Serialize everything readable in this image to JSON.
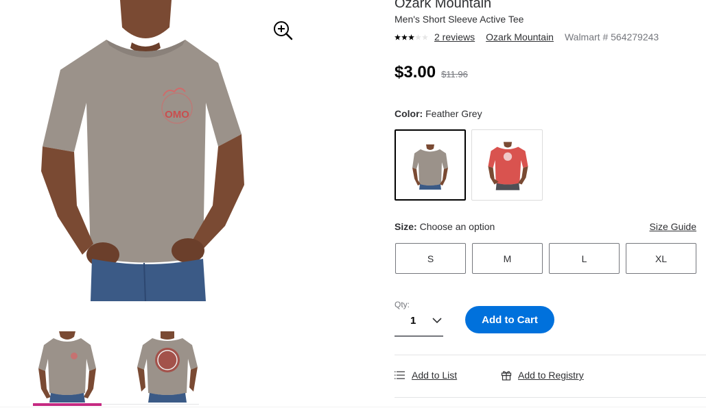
{
  "product": {
    "brand_title": "Ozark Mountain",
    "name": "Men's Short Sleeve Active Tee",
    "rating": 3,
    "rating_max": 5,
    "reviews_label": "2 reviews",
    "brand_link": "Ozark Mountain",
    "walmart_number": "Walmart # 564279243"
  },
  "pricing": {
    "current": "$3.00",
    "was": "$11.96"
  },
  "color": {
    "label": "Color:",
    "selected": "Feather Grey",
    "swatches": [
      "Feather Grey",
      "Red"
    ]
  },
  "size": {
    "label": "Size:",
    "prompt": "Choose an option",
    "guide_label": "Size Guide",
    "options": [
      "S",
      "M",
      "L",
      "XL"
    ]
  },
  "quantity": {
    "label": "Qty:",
    "value": "1"
  },
  "cart": {
    "button_label": "Add to Cart"
  },
  "actions": {
    "add_to_list": "Add to List",
    "add_to_registry": "Add to Registry"
  },
  "gallery": {
    "image_count": 2,
    "selected_index": 0,
    "logo_text": "OMO"
  },
  "colors": {
    "accent_blue": "#0071dc",
    "thumb_indicator": "#c52a82",
    "tee_grey": "#9b928a",
    "tee_red": "#d9534f",
    "text_dark": "#2e2f32",
    "text_muted": "#74767c"
  },
  "icons": {
    "zoom": "zoom-in-icon",
    "star": "star-icon",
    "chevron": "chevron-down-icon",
    "list": "list-icon",
    "registry": "gift-icon"
  }
}
